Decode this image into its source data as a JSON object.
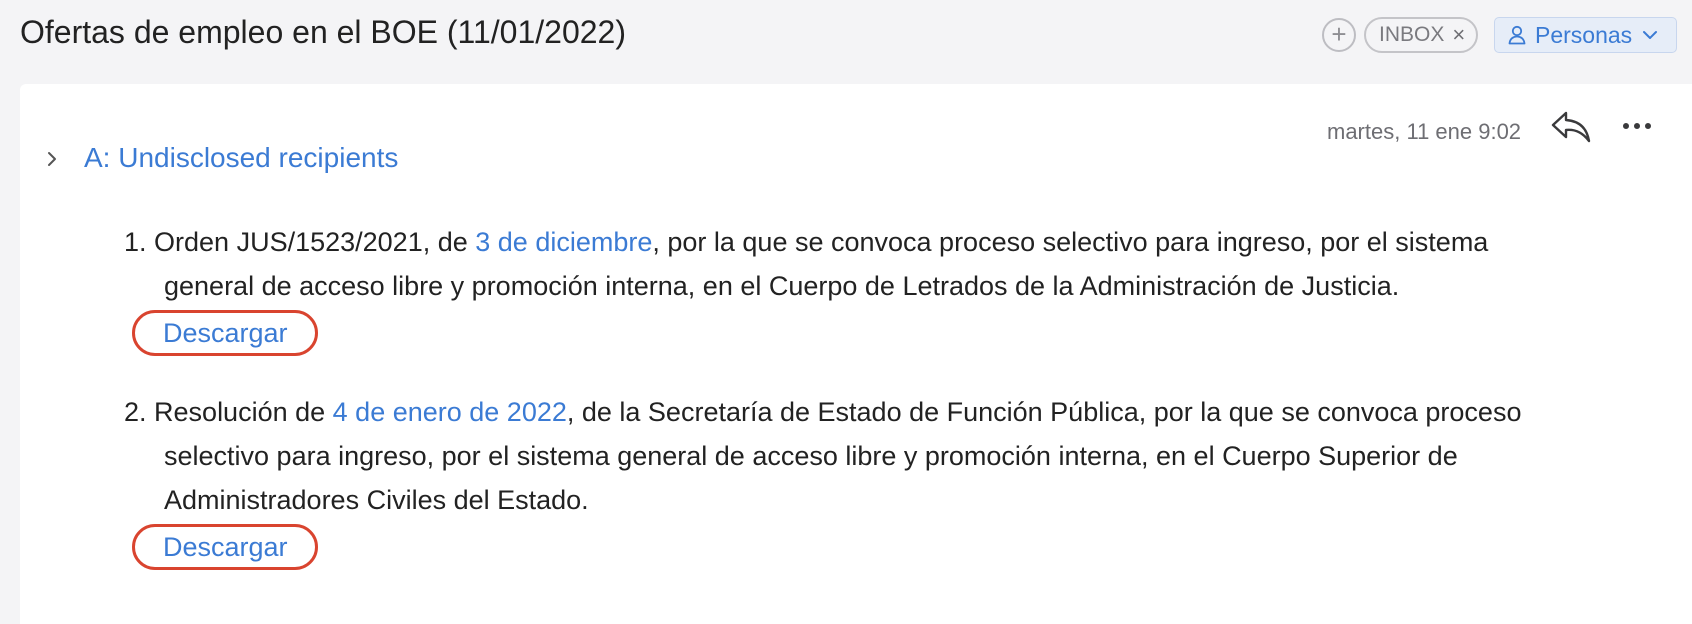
{
  "header": {
    "subject": "Ofertas de empleo en el BOE (11/01/2022)",
    "add_tag_label": "+",
    "tag": "INBOX",
    "tag_remove": "×",
    "people_button": "Personas"
  },
  "message": {
    "recipients": "A: Undisclosed recipients",
    "date": "martes, 11 ene 9:02",
    "items": [
      {
        "number": "1.",
        "line1_pre": " Orden JUS/1523/2021, de ",
        "line1_link": "3 de diciembre",
        "line1_post": ", por la que se convoca proceso selectivo para ingreso, por el sistema",
        "line2": "general de acceso libre y promoción interna, en el Cuerpo de Letrados de la Administración de Justicia.",
        "download": "Descargar"
      },
      {
        "number": "2.",
        "line1_pre": " Resolución de ",
        "line1_link": "4 de enero de 2022",
        "line1_post": ", de la Secretaría de Estado de Función Pública, por la que se convoca proceso",
        "line2": "selectivo para ingreso, por el sistema general de acceso libre y promoción interna, en el Cuerpo Superior de",
        "line3": "Administradores Civiles del Estado.",
        "download": "Descargar"
      }
    ]
  },
  "colors": {
    "link": "#3b7bd4",
    "highlight": "#d9442f",
    "background": "#f4f4f6"
  },
  "icons": [
    "plus-icon",
    "close-icon",
    "person-icon",
    "chevron-down-icon",
    "chevron-right-icon",
    "reply-icon",
    "more-icon"
  ]
}
